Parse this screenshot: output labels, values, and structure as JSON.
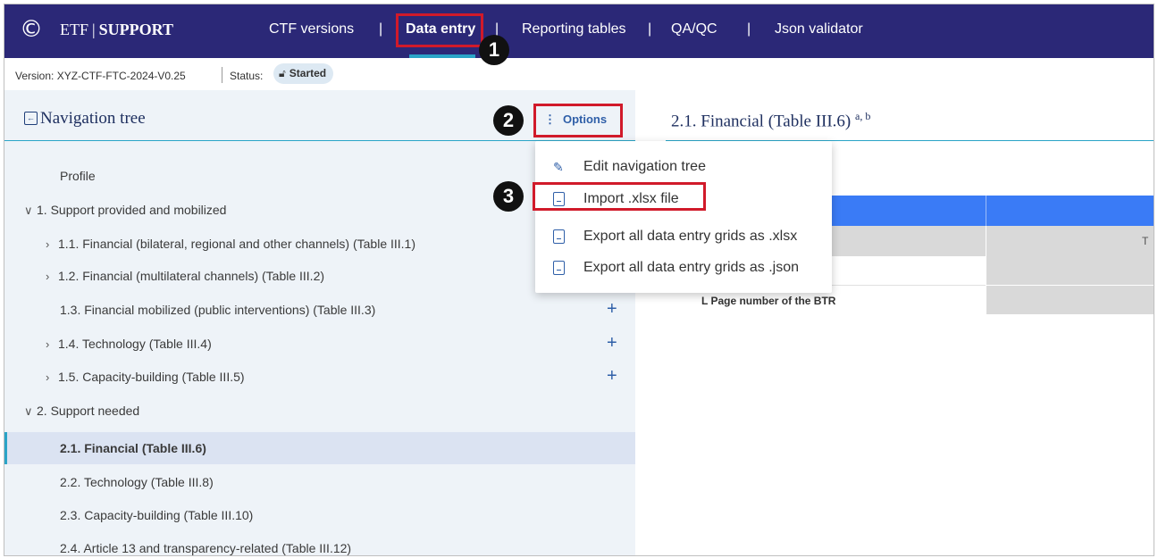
{
  "header": {
    "brand_left": "ETF",
    "brand_right": "SUPPORT",
    "nav": {
      "ctf_versions": "CTF versions",
      "data_entry": "Data entry",
      "reporting_tables": "Reporting tables",
      "qaqc": "QA/QC",
      "json_validator": "Json validator",
      "separator": "|"
    }
  },
  "version_bar": {
    "version_text": "Version: XYZ-CTF-FTC-2024-V0.25",
    "status_label": "Status:",
    "status_value": "Started"
  },
  "navigation_tree": {
    "title": "Navigation tree",
    "options_label": "Options",
    "items": [
      {
        "label": "Profile"
      },
      {
        "label": "1. Support provided and mobilized"
      },
      {
        "label": "1.1. Financial (bilateral, regional and other channels) (Table III.1)"
      },
      {
        "label": "1.2. Financial (multilateral channels) (Table III.2)"
      },
      {
        "label": "1.3. Financial mobilized (public interventions) (Table III.3)"
      },
      {
        "label": "1.4. Technology (Table III.4)"
      },
      {
        "label": "1.5. Capacity-building (Table III.5)"
      },
      {
        "label": "2. Support needed"
      },
      {
        "label": "2.1. Financial (Table III.6)"
      },
      {
        "label": "2.2. Technology (Table III.8)"
      },
      {
        "label": "2.3. Capacity-building (Table III.10)"
      },
      {
        "label": "2.4. Article 13 and transparency-related (Table III.12)"
      }
    ]
  },
  "options_menu": {
    "items": [
      {
        "label": "Edit navigation tree"
      },
      {
        "label": "Import .xlsx file"
      },
      {
        "label": "Export all data entry grids as .xlsx"
      },
      {
        "label": "Export all data entry grids as .json"
      }
    ]
  },
  "content": {
    "title": "2.1. Financial (Table III.6)",
    "title_sup": "a, b",
    "row_label": "L Page number of the BTR",
    "cell_fragment": "T"
  },
  "callouts": [
    "1",
    "2",
    "3"
  ],
  "colors": {
    "topbar": "#2b2877",
    "accent": "#2aa4c7",
    "callout_red": "#d11a2a",
    "grid_header": "#3a7bf6"
  }
}
